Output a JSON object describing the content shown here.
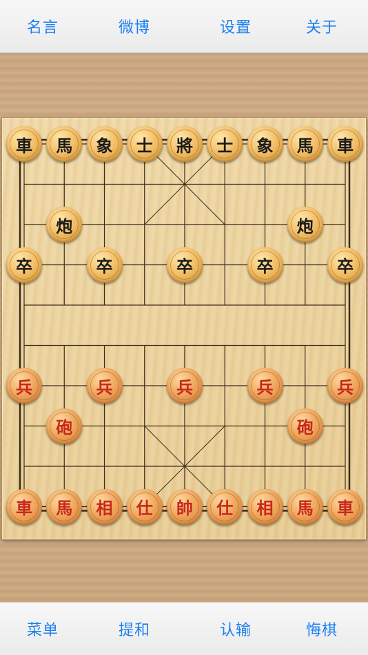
{
  "top_bar": {
    "buttons": [
      {
        "label": "名言"
      },
      {
        "label": "微博"
      },
      {
        "label": "设置"
      },
      {
        "label": "关于"
      }
    ]
  },
  "bottom_bar": {
    "buttons": [
      {
        "label": "菜单"
      },
      {
        "label": "提和"
      },
      {
        "label": "认输"
      },
      {
        "label": "悔棋"
      }
    ]
  },
  "board": {
    "files": 9,
    "ranks": 10,
    "pieces": [
      {
        "label": "車",
        "side": "black",
        "file": 0,
        "rank": 0
      },
      {
        "label": "馬",
        "side": "black",
        "file": 1,
        "rank": 0
      },
      {
        "label": "象",
        "side": "black",
        "file": 2,
        "rank": 0
      },
      {
        "label": "士",
        "side": "black",
        "file": 3,
        "rank": 0
      },
      {
        "label": "將",
        "side": "black",
        "file": 4,
        "rank": 0
      },
      {
        "label": "士",
        "side": "black",
        "file": 5,
        "rank": 0
      },
      {
        "label": "象",
        "side": "black",
        "file": 6,
        "rank": 0
      },
      {
        "label": "馬",
        "side": "black",
        "file": 7,
        "rank": 0
      },
      {
        "label": "車",
        "side": "black",
        "file": 8,
        "rank": 0
      },
      {
        "label": "炮",
        "side": "black",
        "file": 1,
        "rank": 2
      },
      {
        "label": "炮",
        "side": "black",
        "file": 7,
        "rank": 2
      },
      {
        "label": "卒",
        "side": "black",
        "file": 0,
        "rank": 3
      },
      {
        "label": "卒",
        "side": "black",
        "file": 2,
        "rank": 3
      },
      {
        "label": "卒",
        "side": "black",
        "file": 4,
        "rank": 3
      },
      {
        "label": "卒",
        "side": "black",
        "file": 6,
        "rank": 3
      },
      {
        "label": "卒",
        "side": "black",
        "file": 8,
        "rank": 3
      },
      {
        "label": "兵",
        "side": "red",
        "file": 0,
        "rank": 6
      },
      {
        "label": "兵",
        "side": "red",
        "file": 2,
        "rank": 6
      },
      {
        "label": "兵",
        "side": "red",
        "file": 4,
        "rank": 6
      },
      {
        "label": "兵",
        "side": "red",
        "file": 6,
        "rank": 6
      },
      {
        "label": "兵",
        "side": "red",
        "file": 8,
        "rank": 6
      },
      {
        "label": "砲",
        "side": "red",
        "file": 1,
        "rank": 7
      },
      {
        "label": "砲",
        "side": "red",
        "file": 7,
        "rank": 7
      },
      {
        "label": "車",
        "side": "red",
        "file": 0,
        "rank": 9
      },
      {
        "label": "馬",
        "side": "red",
        "file": 1,
        "rank": 9
      },
      {
        "label": "相",
        "side": "red",
        "file": 2,
        "rank": 9
      },
      {
        "label": "仕",
        "side": "red",
        "file": 3,
        "rank": 9
      },
      {
        "label": "帥",
        "side": "red",
        "file": 4,
        "rank": 9
      },
      {
        "label": "仕",
        "side": "red",
        "file": 5,
        "rank": 9
      },
      {
        "label": "相",
        "side": "red",
        "file": 6,
        "rank": 9
      },
      {
        "label": "馬",
        "side": "red",
        "file": 7,
        "rank": 9
      },
      {
        "label": "車",
        "side": "red",
        "file": 8,
        "rank": 9
      }
    ]
  },
  "colors": {
    "accent": "#1a7ff2",
    "red_piece_text": "#c8281c",
    "black_piece_text": "#1a1a1a",
    "grid_line": "#3a2a1a"
  }
}
